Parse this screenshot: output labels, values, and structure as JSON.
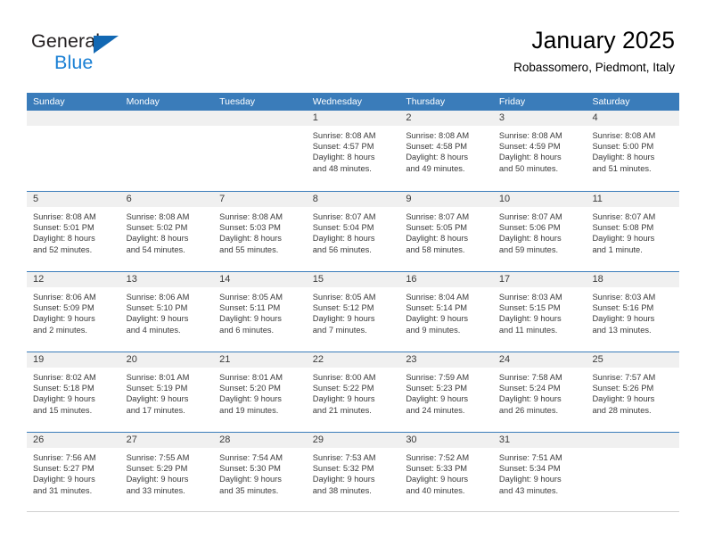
{
  "logo": {
    "word_one": "General",
    "word_two": "Blue",
    "triangle_icon": "triangle-icon",
    "accent_dark": "#1268b3",
    "accent_light": "#1b80d4"
  },
  "header": {
    "title": "January 2025",
    "subtitle": "Robassomero, Piedmont, Italy"
  },
  "theme": {
    "header_bar": "#3a7cba",
    "day_head_bg": "#f0f0f0",
    "text": "#3a3a3a"
  },
  "calendar": {
    "day_headers": [
      "Sunday",
      "Monday",
      "Tuesday",
      "Wednesday",
      "Thursday",
      "Friday",
      "Saturday"
    ],
    "weeks": [
      [
        {
          "num": "",
          "lines": []
        },
        {
          "num": "",
          "lines": []
        },
        {
          "num": "",
          "lines": []
        },
        {
          "num": "1",
          "lines": [
            "Sunrise: 8:08 AM",
            "Sunset: 4:57 PM",
            "Daylight: 8 hours",
            "and 48 minutes."
          ]
        },
        {
          "num": "2",
          "lines": [
            "Sunrise: 8:08 AM",
            "Sunset: 4:58 PM",
            "Daylight: 8 hours",
            "and 49 minutes."
          ]
        },
        {
          "num": "3",
          "lines": [
            "Sunrise: 8:08 AM",
            "Sunset: 4:59 PM",
            "Daylight: 8 hours",
            "and 50 minutes."
          ]
        },
        {
          "num": "4",
          "lines": [
            "Sunrise: 8:08 AM",
            "Sunset: 5:00 PM",
            "Daylight: 8 hours",
            "and 51 minutes."
          ]
        }
      ],
      [
        {
          "num": "5",
          "lines": [
            "Sunrise: 8:08 AM",
            "Sunset: 5:01 PM",
            "Daylight: 8 hours",
            "and 52 minutes."
          ]
        },
        {
          "num": "6",
          "lines": [
            "Sunrise: 8:08 AM",
            "Sunset: 5:02 PM",
            "Daylight: 8 hours",
            "and 54 minutes."
          ]
        },
        {
          "num": "7",
          "lines": [
            "Sunrise: 8:08 AM",
            "Sunset: 5:03 PM",
            "Daylight: 8 hours",
            "and 55 minutes."
          ]
        },
        {
          "num": "8",
          "lines": [
            "Sunrise: 8:07 AM",
            "Sunset: 5:04 PM",
            "Daylight: 8 hours",
            "and 56 minutes."
          ]
        },
        {
          "num": "9",
          "lines": [
            "Sunrise: 8:07 AM",
            "Sunset: 5:05 PM",
            "Daylight: 8 hours",
            "and 58 minutes."
          ]
        },
        {
          "num": "10",
          "lines": [
            "Sunrise: 8:07 AM",
            "Sunset: 5:06 PM",
            "Daylight: 8 hours",
            "and 59 minutes."
          ]
        },
        {
          "num": "11",
          "lines": [
            "Sunrise: 8:07 AM",
            "Sunset: 5:08 PM",
            "Daylight: 9 hours",
            "and 1 minute."
          ]
        }
      ],
      [
        {
          "num": "12",
          "lines": [
            "Sunrise: 8:06 AM",
            "Sunset: 5:09 PM",
            "Daylight: 9 hours",
            "and 2 minutes."
          ]
        },
        {
          "num": "13",
          "lines": [
            "Sunrise: 8:06 AM",
            "Sunset: 5:10 PM",
            "Daylight: 9 hours",
            "and 4 minutes."
          ]
        },
        {
          "num": "14",
          "lines": [
            "Sunrise: 8:05 AM",
            "Sunset: 5:11 PM",
            "Daylight: 9 hours",
            "and 6 minutes."
          ]
        },
        {
          "num": "15",
          "lines": [
            "Sunrise: 8:05 AM",
            "Sunset: 5:12 PM",
            "Daylight: 9 hours",
            "and 7 minutes."
          ]
        },
        {
          "num": "16",
          "lines": [
            "Sunrise: 8:04 AM",
            "Sunset: 5:14 PM",
            "Daylight: 9 hours",
            "and 9 minutes."
          ]
        },
        {
          "num": "17",
          "lines": [
            "Sunrise: 8:03 AM",
            "Sunset: 5:15 PM",
            "Daylight: 9 hours",
            "and 11 minutes."
          ]
        },
        {
          "num": "18",
          "lines": [
            "Sunrise: 8:03 AM",
            "Sunset: 5:16 PM",
            "Daylight: 9 hours",
            "and 13 minutes."
          ]
        }
      ],
      [
        {
          "num": "19",
          "lines": [
            "Sunrise: 8:02 AM",
            "Sunset: 5:18 PM",
            "Daylight: 9 hours",
            "and 15 minutes."
          ]
        },
        {
          "num": "20",
          "lines": [
            "Sunrise: 8:01 AM",
            "Sunset: 5:19 PM",
            "Daylight: 9 hours",
            "and 17 minutes."
          ]
        },
        {
          "num": "21",
          "lines": [
            "Sunrise: 8:01 AM",
            "Sunset: 5:20 PM",
            "Daylight: 9 hours",
            "and 19 minutes."
          ]
        },
        {
          "num": "22",
          "lines": [
            "Sunrise: 8:00 AM",
            "Sunset: 5:22 PM",
            "Daylight: 9 hours",
            "and 21 minutes."
          ]
        },
        {
          "num": "23",
          "lines": [
            "Sunrise: 7:59 AM",
            "Sunset: 5:23 PM",
            "Daylight: 9 hours",
            "and 24 minutes."
          ]
        },
        {
          "num": "24",
          "lines": [
            "Sunrise: 7:58 AM",
            "Sunset: 5:24 PM",
            "Daylight: 9 hours",
            "and 26 minutes."
          ]
        },
        {
          "num": "25",
          "lines": [
            "Sunrise: 7:57 AM",
            "Sunset: 5:26 PM",
            "Daylight: 9 hours",
            "and 28 minutes."
          ]
        }
      ],
      [
        {
          "num": "26",
          "lines": [
            "Sunrise: 7:56 AM",
            "Sunset: 5:27 PM",
            "Daylight: 9 hours",
            "and 31 minutes."
          ]
        },
        {
          "num": "27",
          "lines": [
            "Sunrise: 7:55 AM",
            "Sunset: 5:29 PM",
            "Daylight: 9 hours",
            "and 33 minutes."
          ]
        },
        {
          "num": "28",
          "lines": [
            "Sunrise: 7:54 AM",
            "Sunset: 5:30 PM",
            "Daylight: 9 hours",
            "and 35 minutes."
          ]
        },
        {
          "num": "29",
          "lines": [
            "Sunrise: 7:53 AM",
            "Sunset: 5:32 PM",
            "Daylight: 9 hours",
            "and 38 minutes."
          ]
        },
        {
          "num": "30",
          "lines": [
            "Sunrise: 7:52 AM",
            "Sunset: 5:33 PM",
            "Daylight: 9 hours",
            "and 40 minutes."
          ]
        },
        {
          "num": "31",
          "lines": [
            "Sunrise: 7:51 AM",
            "Sunset: 5:34 PM",
            "Daylight: 9 hours",
            "and 43 minutes."
          ]
        },
        {
          "num": "",
          "lines": []
        }
      ]
    ]
  }
}
